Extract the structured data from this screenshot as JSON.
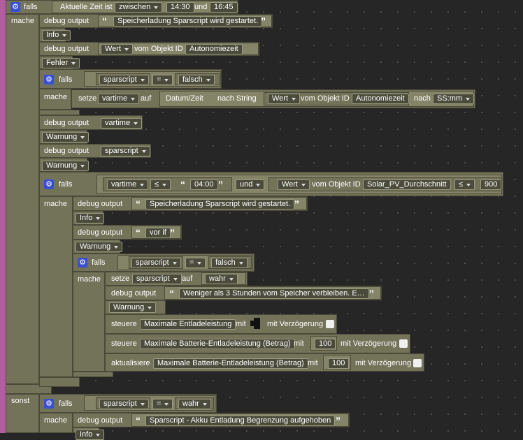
{
  "kw": {
    "falls": "falls",
    "mache": "mache",
    "sonst": "sonst",
    "debug_output": "debug output",
    "setze": "setze",
    "auf": "auf",
    "und": "und",
    "steuere": "steuere",
    "aktualisiere": "aktualisiere",
    "mit": "mit",
    "mit_verzoegerung": "mit Verzögerung",
    "wert": "Wert",
    "vom_objekt_id": "vom Objekt ID",
    "datum_zeit": "Datum/Zeit",
    "nach_string": "nach String",
    "nach": "nach",
    "quote_open": "“",
    "quote_close": "”"
  },
  "top": {
    "cond_text": "Aktuelle Zeit ist",
    "mode": "zwischen",
    "from": "14:30",
    "to": "16:45"
  },
  "debug1": {
    "text": "Speicherladung Sparscript wird gestartet.",
    "level": "Info"
  },
  "debug2": {
    "object_id": "Autonomiezeit",
    "level": "Fehler"
  },
  "if1": {
    "var": "sparscript",
    "op": "=",
    "value": "falsch"
  },
  "set1": {
    "var": "vartime",
    "object_id": "Autonomiezeit",
    "format": "SS:mm"
  },
  "debug3": {
    "var": "vartime",
    "level": "Warnung"
  },
  "debug4": {
    "var": "sparscript",
    "level": "Warnung"
  },
  "if2": {
    "var": "vartime",
    "op1": "≤",
    "time": "04:00",
    "logic": "und",
    "object_id": "Solar_PV_Durchschnitt",
    "op2": "≤",
    "num": "900"
  },
  "debug5": {
    "text": "Speicherladung Sparscript wird gestartet.",
    "level": "Info"
  },
  "debug6": {
    "text": "vor if",
    "level": "Warnung"
  },
  "if3": {
    "var": "sparscript",
    "op": "=",
    "value": "falsch"
  },
  "set2": {
    "var": "sparscript",
    "value": "wahr"
  },
  "debug7": {
    "text": "Weniger als 3 Stunden vom Speicher verbleiben. E…",
    "level": "Warnung"
  },
  "ctrl1": {
    "target": "Maximale Entladeleistung"
  },
  "ctrl2": {
    "target": "Maximale Batterie-Entladeleistung (Betrag)",
    "value": "100"
  },
  "upd1": {
    "target": "Maximale Batterie-Entladeleistung (Betrag)",
    "value": "100"
  },
  "else_if": {
    "var": "sparscript",
    "op": "=",
    "value": "wahr"
  },
  "debug8": {
    "text": "Sparscript - Akku Entladung Begrenzung aufgehoben",
    "level": "Info"
  }
}
